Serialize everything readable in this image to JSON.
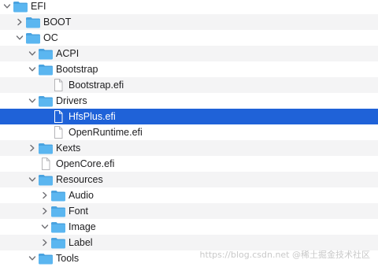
{
  "tree": {
    "rows": [
      {
        "label": "EFI",
        "depth": 0,
        "type": "folder",
        "expander": "open"
      },
      {
        "label": "BOOT",
        "depth": 1,
        "type": "folder",
        "expander": "closed"
      },
      {
        "label": "OC",
        "depth": 1,
        "type": "folder",
        "expander": "open"
      },
      {
        "label": "ACPI",
        "depth": 2,
        "type": "folder",
        "expander": "open"
      },
      {
        "label": "Bootstrap",
        "depth": 2,
        "type": "folder",
        "expander": "open"
      },
      {
        "label": "Bootstrap.efi",
        "depth": 3,
        "type": "file",
        "expander": "none"
      },
      {
        "label": "Drivers",
        "depth": 2,
        "type": "folder",
        "expander": "open"
      },
      {
        "label": "HfsPlus.efi",
        "depth": 3,
        "type": "file",
        "expander": "none",
        "selected": true
      },
      {
        "label": "OpenRuntime.efi",
        "depth": 3,
        "type": "file",
        "expander": "none"
      },
      {
        "label": "Kexts",
        "depth": 2,
        "type": "folder",
        "expander": "closed"
      },
      {
        "label": "OpenCore.efi",
        "depth": 2,
        "type": "file",
        "expander": "none"
      },
      {
        "label": "Resources",
        "depth": 2,
        "type": "folder",
        "expander": "open"
      },
      {
        "label": "Audio",
        "depth": 3,
        "type": "folder",
        "expander": "closed"
      },
      {
        "label": "Font",
        "depth": 3,
        "type": "folder",
        "expander": "closed"
      },
      {
        "label": "Image",
        "depth": 3,
        "type": "folder",
        "expander": "open"
      },
      {
        "label": "Label",
        "depth": 3,
        "type": "folder",
        "expander": "closed"
      },
      {
        "label": "Tools",
        "depth": 2,
        "type": "folder",
        "expander": "open"
      }
    ]
  },
  "watermark": "https://blog.csdn.net @稀土掘金技术社区",
  "colors": {
    "selection": "#1f62d8",
    "folder": "#5bb6f0",
    "folder_tab": "#4aa3e0",
    "stripe": "#f4f4f5"
  }
}
